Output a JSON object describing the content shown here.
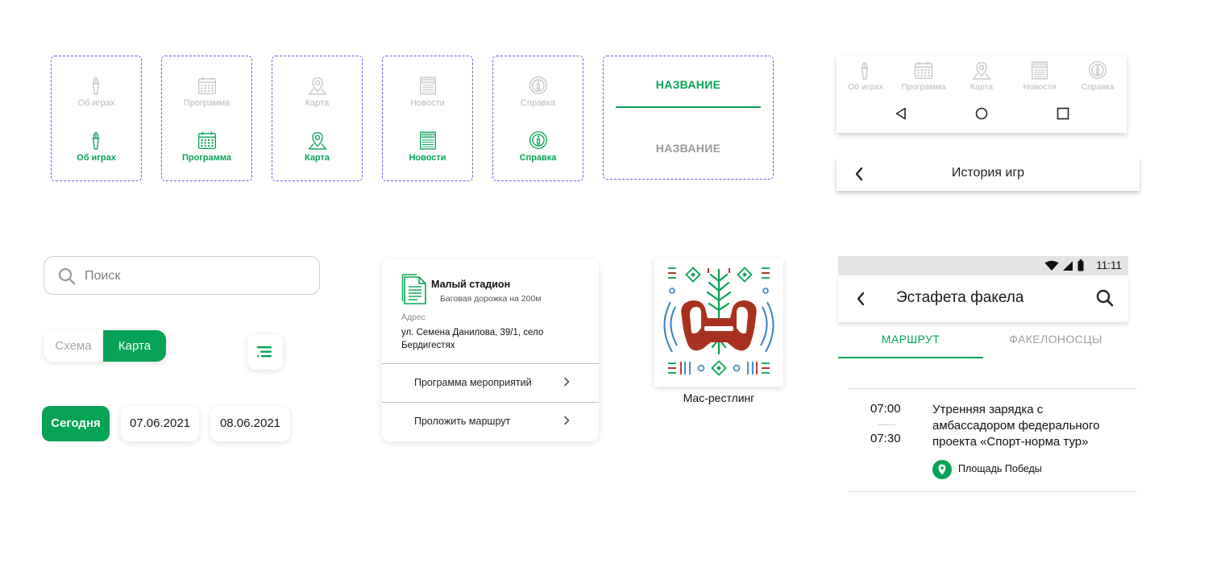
{
  "nav_variants": [
    {
      "icon": "torch-icon",
      "label": "Об играх"
    },
    {
      "icon": "calendar-icon",
      "label": "Программа"
    },
    {
      "icon": "map-pin-icon",
      "label": "Карта"
    },
    {
      "icon": "newspaper-icon",
      "label": "Новости"
    },
    {
      "icon": "info-icon",
      "label": "Справка"
    }
  ],
  "newspaper_glyph_text": "NEWS",
  "tabs_component": {
    "active_label": "НАЗВАНИЕ",
    "inactive_label": "НАЗВАНИЕ"
  },
  "bottom_nav": {
    "items": [
      {
        "icon": "torch-icon",
        "label": "Об играх"
      },
      {
        "icon": "calendar-icon",
        "label": "Программа"
      },
      {
        "icon": "map-pin-icon",
        "label": "Карта"
      },
      {
        "icon": "newspaper-icon",
        "label": "Новости"
      },
      {
        "icon": "info-icon",
        "label": "Справка"
      }
    ],
    "system_buttons": [
      "back-triangle-icon",
      "home-circle-icon",
      "recents-square-icon"
    ]
  },
  "history_header": {
    "title": "История игр"
  },
  "search": {
    "placeholder": "Поиск"
  },
  "view_toggle": {
    "option_a": "Схема",
    "option_b": "Карта",
    "selected": "Карта"
  },
  "date_chips": [
    {
      "label": "Сегодня",
      "selected": true
    },
    {
      "label": "07.06.2021",
      "selected": false
    },
    {
      "label": "08.06.2021",
      "selected": false
    }
  ],
  "location_card": {
    "name": "Малый стадион",
    "subtitle": "Баговая дорожка на 200м",
    "address_label": "Адрес",
    "address": "ул. Семена Данилова, 39/1, село Бердигестях",
    "actions": [
      "Программа мероприятий",
      "Проложить маршрут"
    ]
  },
  "sport_card": {
    "name": "Мас-рестлинг"
  },
  "phone": {
    "status_time": "11:11",
    "title": "Эстафета факела",
    "tabs": [
      "МАРШРУТ",
      "ФАКЕЛОНОСЦЫ"
    ],
    "event": {
      "start": "07:00",
      "end": "07:30",
      "title": "Утренняя зарядка с амбассадором федерального проекта «Спорт-норма тур»",
      "place": "Площадь Победы"
    }
  },
  "colors": {
    "accent": "#06a356",
    "dashed_border": "#6f5be6",
    "muted": "#b9b9b9",
    "ornament_red": "#a8321e",
    "ornament_blue": "#3a7fc1"
  }
}
